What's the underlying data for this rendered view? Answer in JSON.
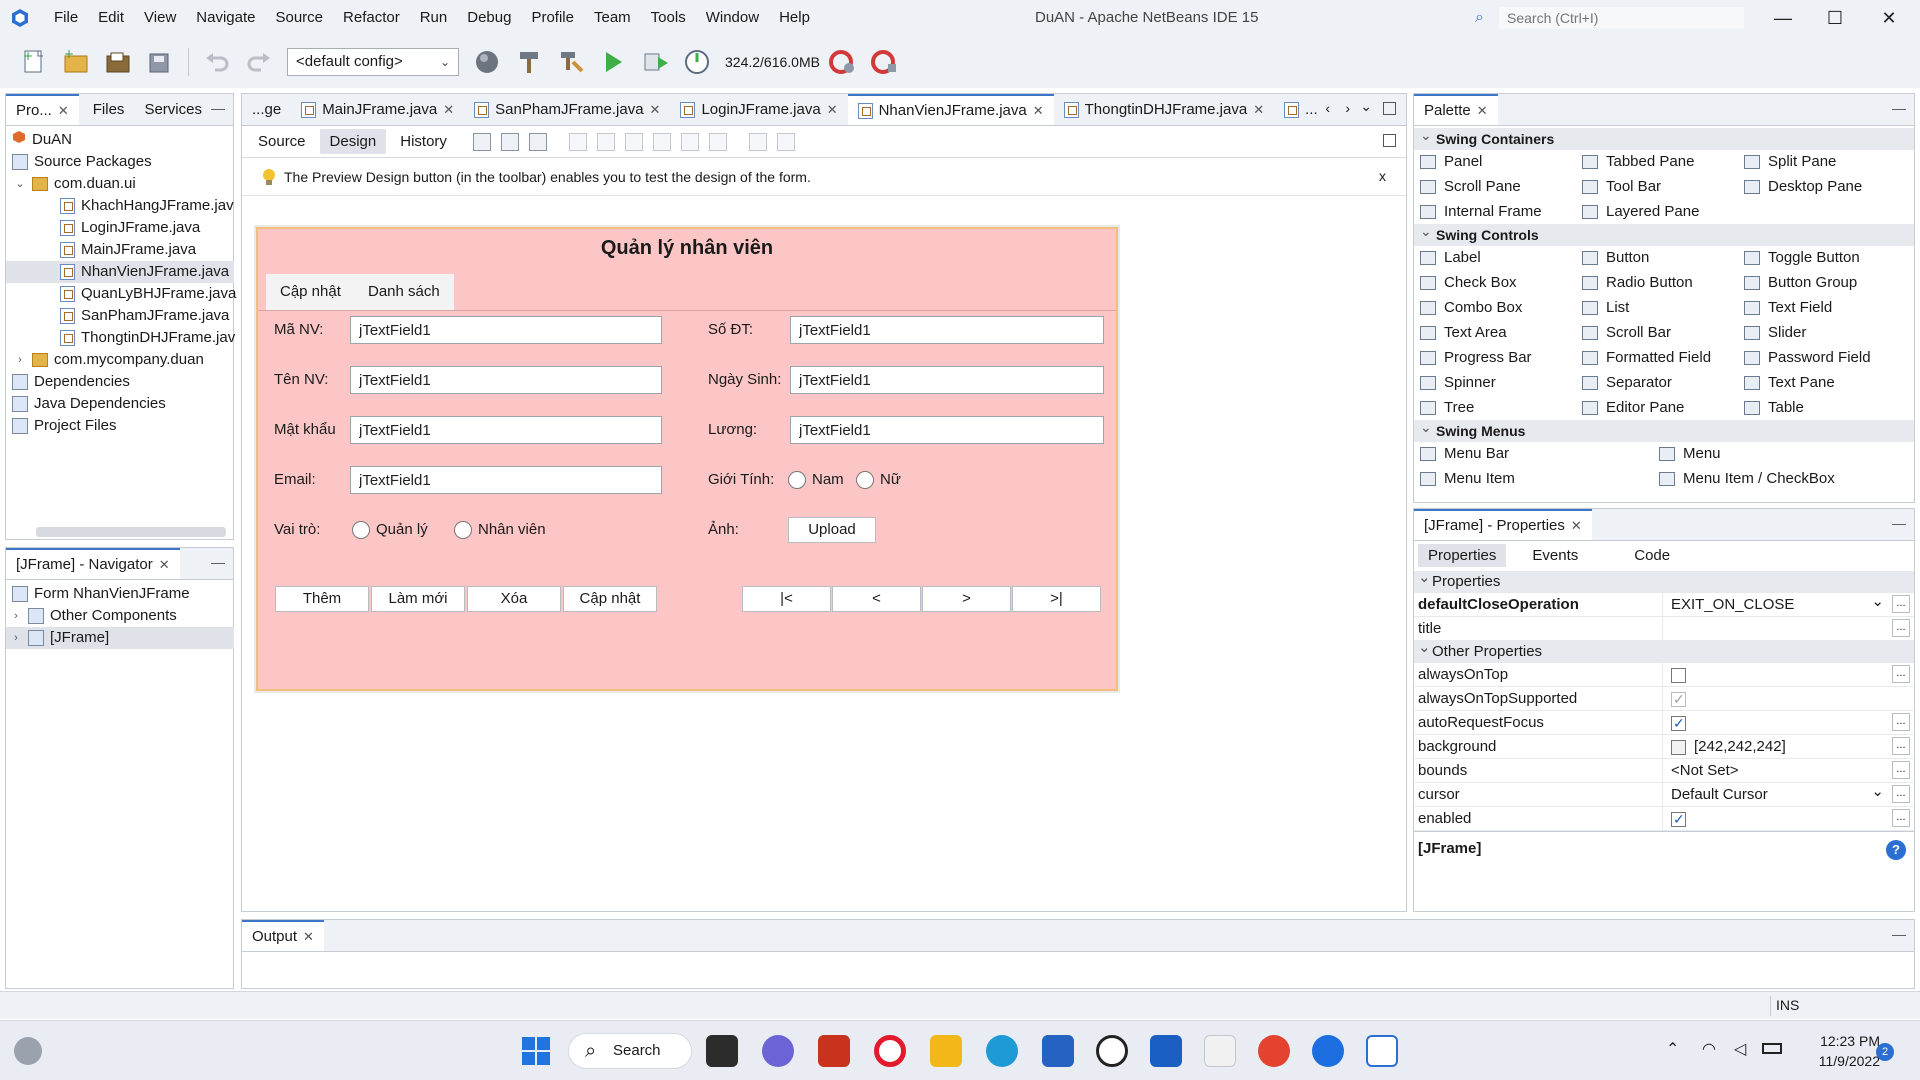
{
  "menu": [
    "File",
    "Edit",
    "View",
    "Navigate",
    "Source",
    "Refactor",
    "Run",
    "Debug",
    "Profile",
    "Team",
    "Tools",
    "Window",
    "Help"
  ],
  "window_title": "DuAN - Apache NetBeans IDE 15",
  "search_placeholder": "Search (Ctrl+I)",
  "window_buttons": {
    "minimize": "—",
    "maximize": "☐",
    "close": "✕"
  },
  "toolbar": {
    "config": "<default config>",
    "memory": "324.2/616.0MB"
  },
  "project_panel": {
    "tabs": [
      "Pro...",
      "Files",
      "Services"
    ],
    "tree": [
      "DuAN",
      "Source Packages",
      "com.duan.ui",
      "KhachHangJFrame.jav",
      "LoginJFrame.java",
      "MainJFrame.java",
      "NhanVienJFrame.java",
      "QuanLyBHJFrame.java",
      "SanPhamJFrame.java",
      "ThongtinDHJFrame.jav",
      "com.mycompany.duan",
      "Dependencies",
      "Java Dependencies",
      "Project Files"
    ]
  },
  "navigator": {
    "title": "[JFrame] - Navigator",
    "tree": [
      "Form NhanVienJFrame",
      "Other Components",
      "[JFrame]"
    ]
  },
  "editor": {
    "tabs": [
      "...ge",
      "MainJFrame.java",
      "SanPhamJFrame.java",
      "LoginJFrame.java",
      "NhanVienJFrame.java",
      "ThongtinDHJFrame.java",
      "..."
    ],
    "view_tabs": [
      "Source",
      "Design",
      "History"
    ],
    "hint": "The Preview Design button (in the toolbar) enables you to test the design of the form.",
    "hint_close": "x"
  },
  "form": {
    "title": "Quản lý nhân viên",
    "tabs": [
      "Cập nhật",
      "Danh sách"
    ],
    "left_labels": [
      "Mã NV:",
      "Tên NV:",
      "Mật khẩu",
      "Email:"
    ],
    "right_labels": [
      "Số ĐT:",
      "Ngày Sinh:",
      "Lương:",
      "Giới Tính:"
    ],
    "field_value": "jTextField1",
    "role_label": "Vai trò:",
    "roles": [
      "Quản lý",
      "Nhân viên"
    ],
    "genders": [
      "Nam",
      "Nữ"
    ],
    "photo_label": "Ảnh:",
    "upload": "Upload",
    "action_buttons": [
      "Thêm",
      "Làm mới",
      "Xóa",
      "Cập nhật"
    ],
    "nav_buttons": [
      "|<",
      "<",
      ">",
      ">|"
    ]
  },
  "palette": {
    "title": "Palette",
    "sections": [
      {
        "name": "Swing Containers",
        "items": [
          "Panel",
          "Tabbed Pane",
          "Split Pane",
          "Scroll Pane",
          "Tool Bar",
          "Desktop Pane",
          "Internal Frame",
          "Layered Pane"
        ]
      },
      {
        "name": "Swing Controls",
        "items": [
          "Label",
          "Button",
          "Toggle Button",
          "Check Box",
          "Radio Button",
          "Button Group",
          "Combo Box",
          "List",
          "Text Field",
          "Text Area",
          "Scroll Bar",
          "Slider",
          "Progress Bar",
          "Formatted Field",
          "Password Field",
          "Spinner",
          "Separator",
          "Text Pane",
          "Tree",
          "Editor Pane",
          "Table"
        ]
      },
      {
        "name": "Swing Menus",
        "items": [
          "Menu Bar",
          "Menu",
          "Menu Item",
          "Menu Item / CheckBox"
        ]
      }
    ]
  },
  "properties": {
    "title": "[JFrame] - Properties",
    "tabs": [
      "Properties",
      "Events",
      "Code"
    ],
    "section1": "Properties",
    "section2": "Other Properties",
    "rows": [
      {
        "name": "defaultCloseOperation",
        "value": "EXIT_ON_CLOSE"
      },
      {
        "name": "title",
        "value": ""
      },
      {
        "name": "alwaysOnTop",
        "value": ""
      },
      {
        "name": "alwaysOnTopSupported",
        "value": ""
      },
      {
        "name": "autoRequestFocus",
        "value": ""
      },
      {
        "name": "background",
        "value": "[242,242,242]"
      },
      {
        "name": "bounds",
        "value": "<Not Set>"
      },
      {
        "name": "cursor",
        "value": "Default Cursor"
      },
      {
        "name": "enabled",
        "value": ""
      }
    ],
    "footer": "[JFrame]"
  },
  "output": {
    "title": "Output"
  },
  "status": {
    "mode": "INS"
  },
  "taskbar": {
    "search": "Search",
    "time": "12:23 PM",
    "date": "11/9/2022",
    "notifications": "2"
  },
  "colors": {
    "form_bg": "#fdc6c6",
    "accent": "#3b74c9"
  }
}
